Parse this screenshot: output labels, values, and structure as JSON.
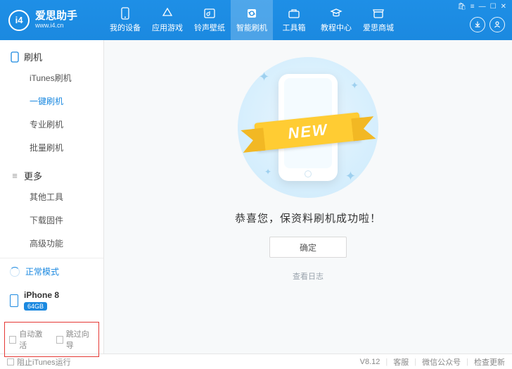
{
  "brand": {
    "logo_text": "i4",
    "name": "爱思助手",
    "url": "www.i4.cn"
  },
  "topnav": [
    {
      "id": "devices",
      "label": "我的设备"
    },
    {
      "id": "apps",
      "label": "应用游戏"
    },
    {
      "id": "ringtones",
      "label": "铃声壁纸"
    },
    {
      "id": "flash",
      "label": "智能刷机"
    },
    {
      "id": "toolbox",
      "label": "工具箱"
    },
    {
      "id": "tutorial",
      "label": "教程中心"
    },
    {
      "id": "store",
      "label": "爱思商城"
    }
  ],
  "sidebar": {
    "cat_flash": "刷机",
    "items_flash": [
      {
        "id": "itunes-flash",
        "label": "iTunes刷机"
      },
      {
        "id": "onekey-flash",
        "label": "一键刷机"
      },
      {
        "id": "pro-flash",
        "label": "专业刷机"
      },
      {
        "id": "batch-flash",
        "label": "批量刷机"
      }
    ],
    "cat_more": "更多",
    "items_more": [
      {
        "id": "other-tools",
        "label": "其他工具"
      },
      {
        "id": "dl-fw",
        "label": "下载固件"
      },
      {
        "id": "advanced",
        "label": "高级功能"
      }
    ]
  },
  "mode": {
    "label": "正常模式"
  },
  "device": {
    "name": "iPhone 8",
    "storage": "64GB"
  },
  "options": {
    "auto_activate": "自动激活",
    "skip_guide": "跳过向导"
  },
  "main": {
    "ribbon": "NEW",
    "message": "恭喜您，保资料刷机成功啦！",
    "ok": "确定",
    "view_log": "查看日志"
  },
  "footer": {
    "block_itunes": "阻止iTunes运行",
    "version": "V8.12",
    "support": "客服",
    "wechat": "微信公众号",
    "check_update": "检查更新"
  }
}
